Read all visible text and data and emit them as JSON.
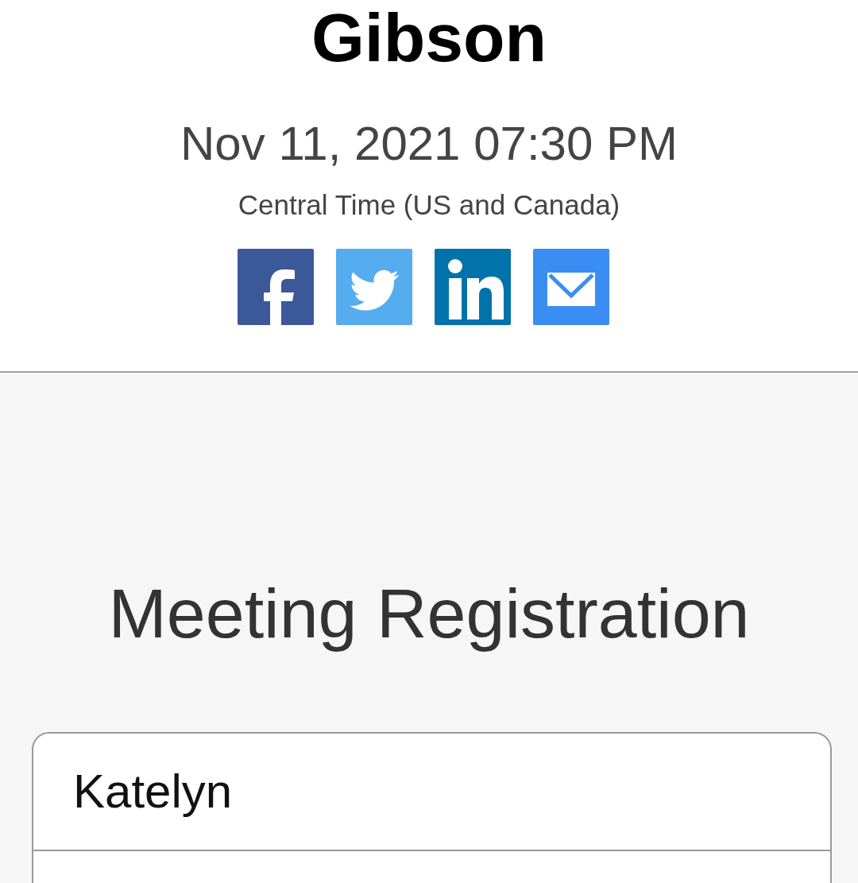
{
  "event": {
    "title": "Gibson",
    "datetime": "Nov 11, 2021 07:30 PM",
    "timezone": "Central Time (US and Canada)",
    "share": [
      {
        "kind": "facebook"
      },
      {
        "kind": "twitter"
      },
      {
        "kind": "linkedin"
      },
      {
        "kind": "email"
      }
    ]
  },
  "registration": {
    "heading": "Meeting Registration",
    "fields": [
      {
        "kind": "text",
        "value": "Katelyn"
      },
      {
        "kind": "text"
      }
    ]
  }
}
